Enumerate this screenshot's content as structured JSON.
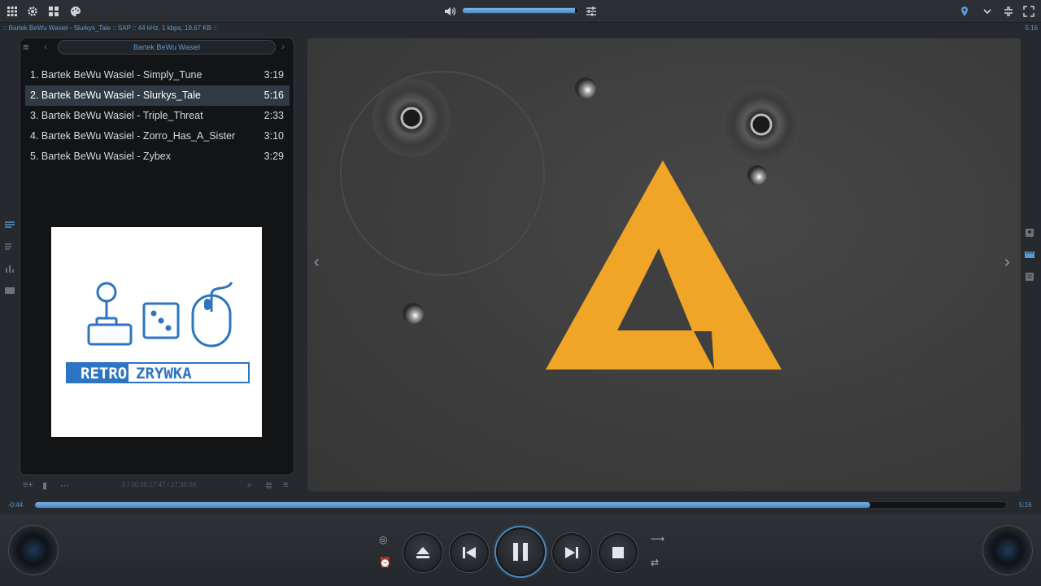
{
  "top_bar": {
    "icons": [
      "apps-grid-icon",
      "gear-icon",
      "grid-icon",
      "palette-icon",
      "volume-icon",
      "equalizer-icon",
      "location-pin-icon",
      "chevron-down-icon",
      "minimize-icon",
      "fullscreen-icon"
    ],
    "volume_level": 0.97
  },
  "info_bar": {
    "text": ":: Bartek BeWu Wasiel - Slurkys_Tale :: SAP :: 44 kHz, 1 kbps, 19,67 KB ::",
    "time": "5:16"
  },
  "playlist": {
    "title": "Bartek BeWu Wasiel",
    "tracks": [
      {
        "label": "1. Bartek BeWu Wasiel - Simply_Tune",
        "duration": "3:19"
      },
      {
        "label": "2. Bartek BeWu Wasiel - Slurkys_Tale",
        "duration": "5:16",
        "active": true
      },
      {
        "label": "3. Bartek BeWu Wasiel - Triple_Threat",
        "duration": "2:33"
      },
      {
        "label": "4. Bartek BeWu Wasiel - Zorro_Has_A_Sister",
        "duration": "3:10"
      },
      {
        "label": "5. Bartek BeWu Wasiel - Zybex",
        "duration": "3:29"
      }
    ],
    "footer_status": "5 / 00:00:17:47 / 17:36:58",
    "cover_art": {
      "logo_text_left": "RETRO",
      "logo_text_right": "ZRYWKA"
    }
  },
  "progress": {
    "elapsed": "-0:44",
    "total": "5:16",
    "fraction": 0.86
  },
  "controls": {
    "buttons": [
      "eject-icon",
      "previous-icon",
      "pause-icon",
      "next-icon",
      "stop-icon"
    ],
    "aux": [
      "podcast-icon",
      "alarm-add-icon",
      "shuffle-icon",
      "repeat-icon"
    ]
  },
  "colors": {
    "accent": "#5b9bd5",
    "logo_orange": "#f0a527",
    "background": "#26292d"
  }
}
